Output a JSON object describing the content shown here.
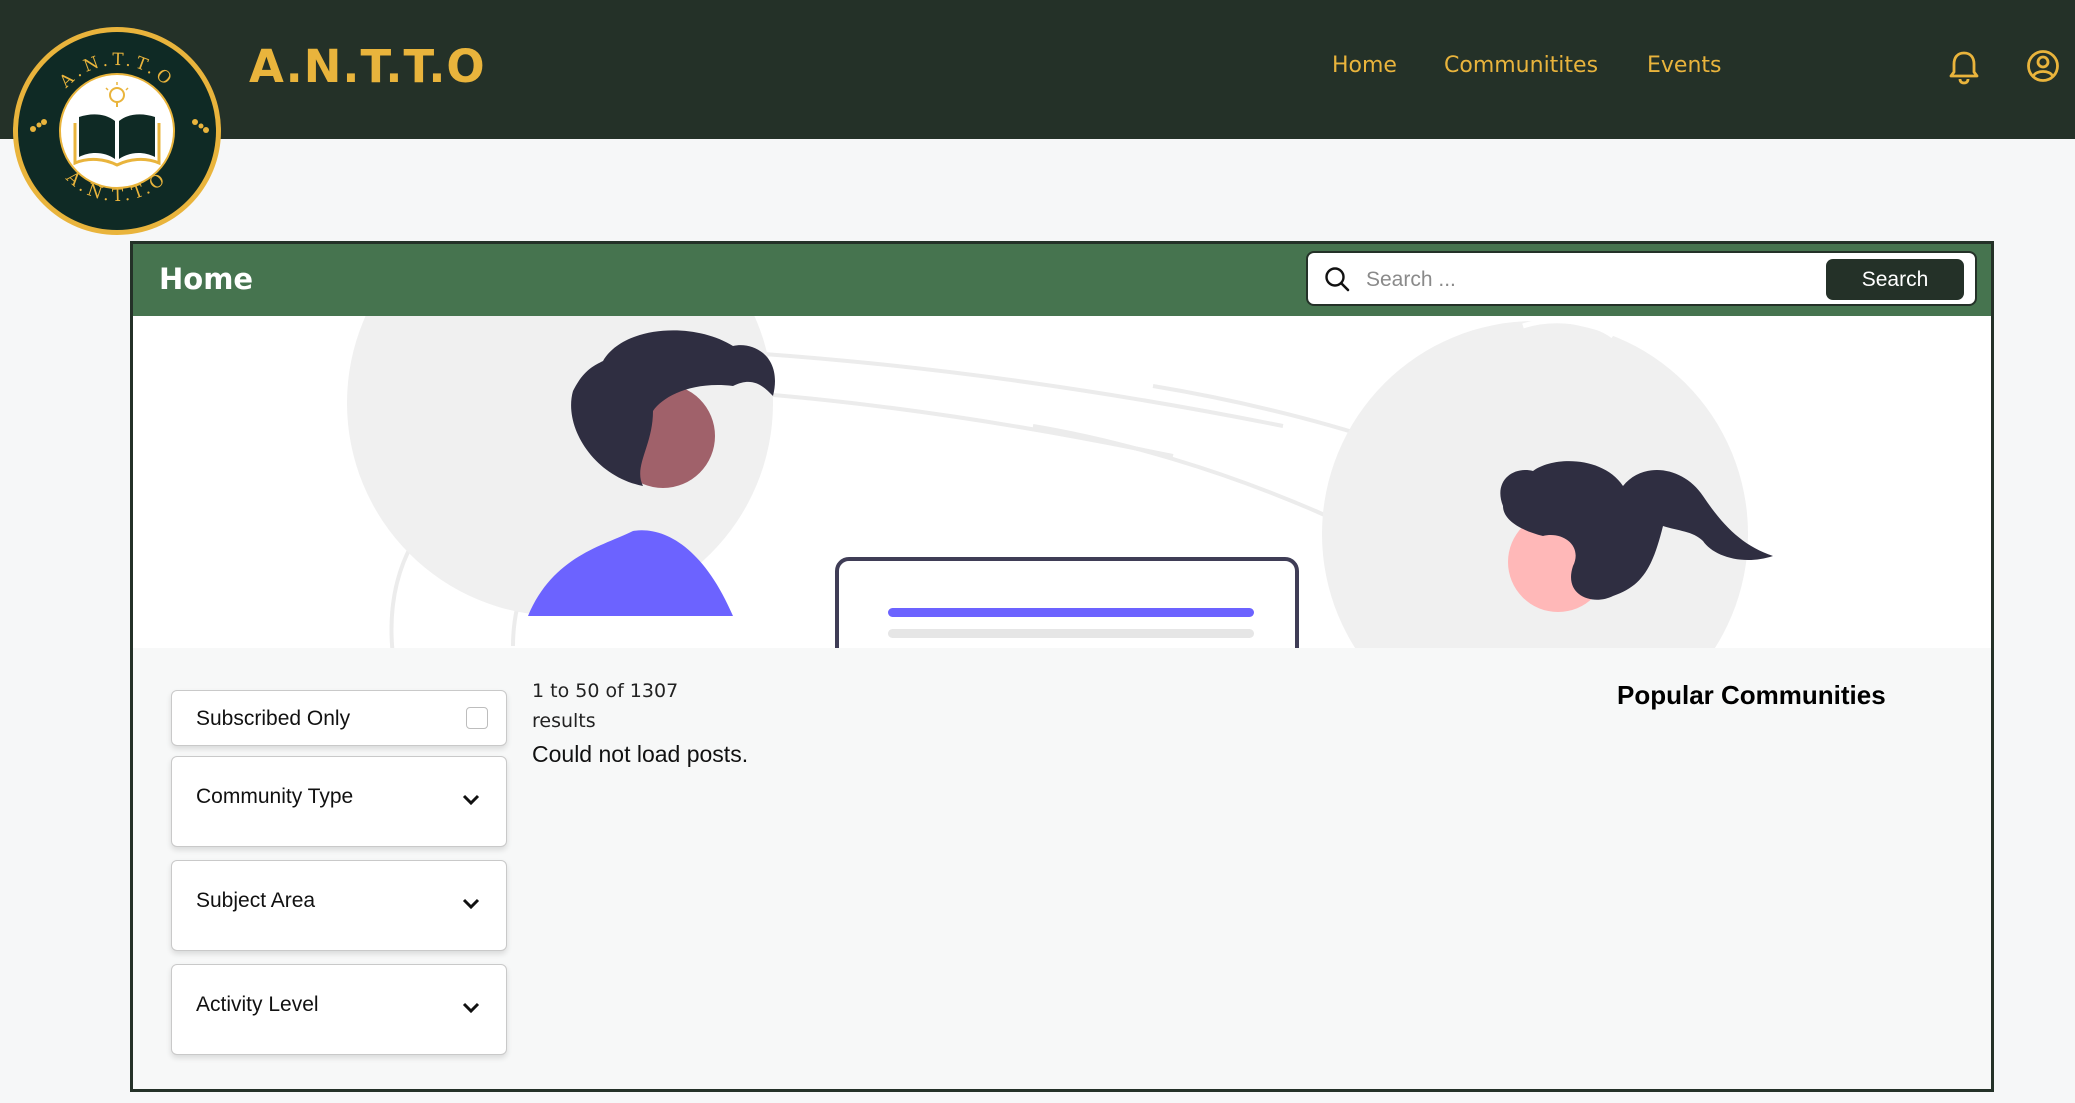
{
  "app": {
    "brand": "A.N.T.T.O",
    "logo_ring_text": "A.N.T.T.O"
  },
  "nav": {
    "links": [
      "Home",
      "Communitites",
      "Events"
    ]
  },
  "icons": {
    "notification": "bell-icon",
    "account": "user-circle-icon",
    "search": "search-icon",
    "chevron": "chevron-down-icon"
  },
  "panel": {
    "title": "Home",
    "search_placeholder": "Search ...",
    "search_button": "Search"
  },
  "filters": {
    "subscribed_only": "Subscribed Only",
    "community_type": "Community Type",
    "subject_area": "Subject Area",
    "activity_level": "Activity Level"
  },
  "results": {
    "count_text": "1 to 50 of 1307 results",
    "error": "Could not load posts."
  },
  "sidebar": {
    "popular_title": "Popular Communities"
  },
  "colors": {
    "nav_bg": "#243128",
    "accent": "#e9b43c",
    "header_green": "#46744f",
    "illustration_purple": "#6c63ff"
  }
}
